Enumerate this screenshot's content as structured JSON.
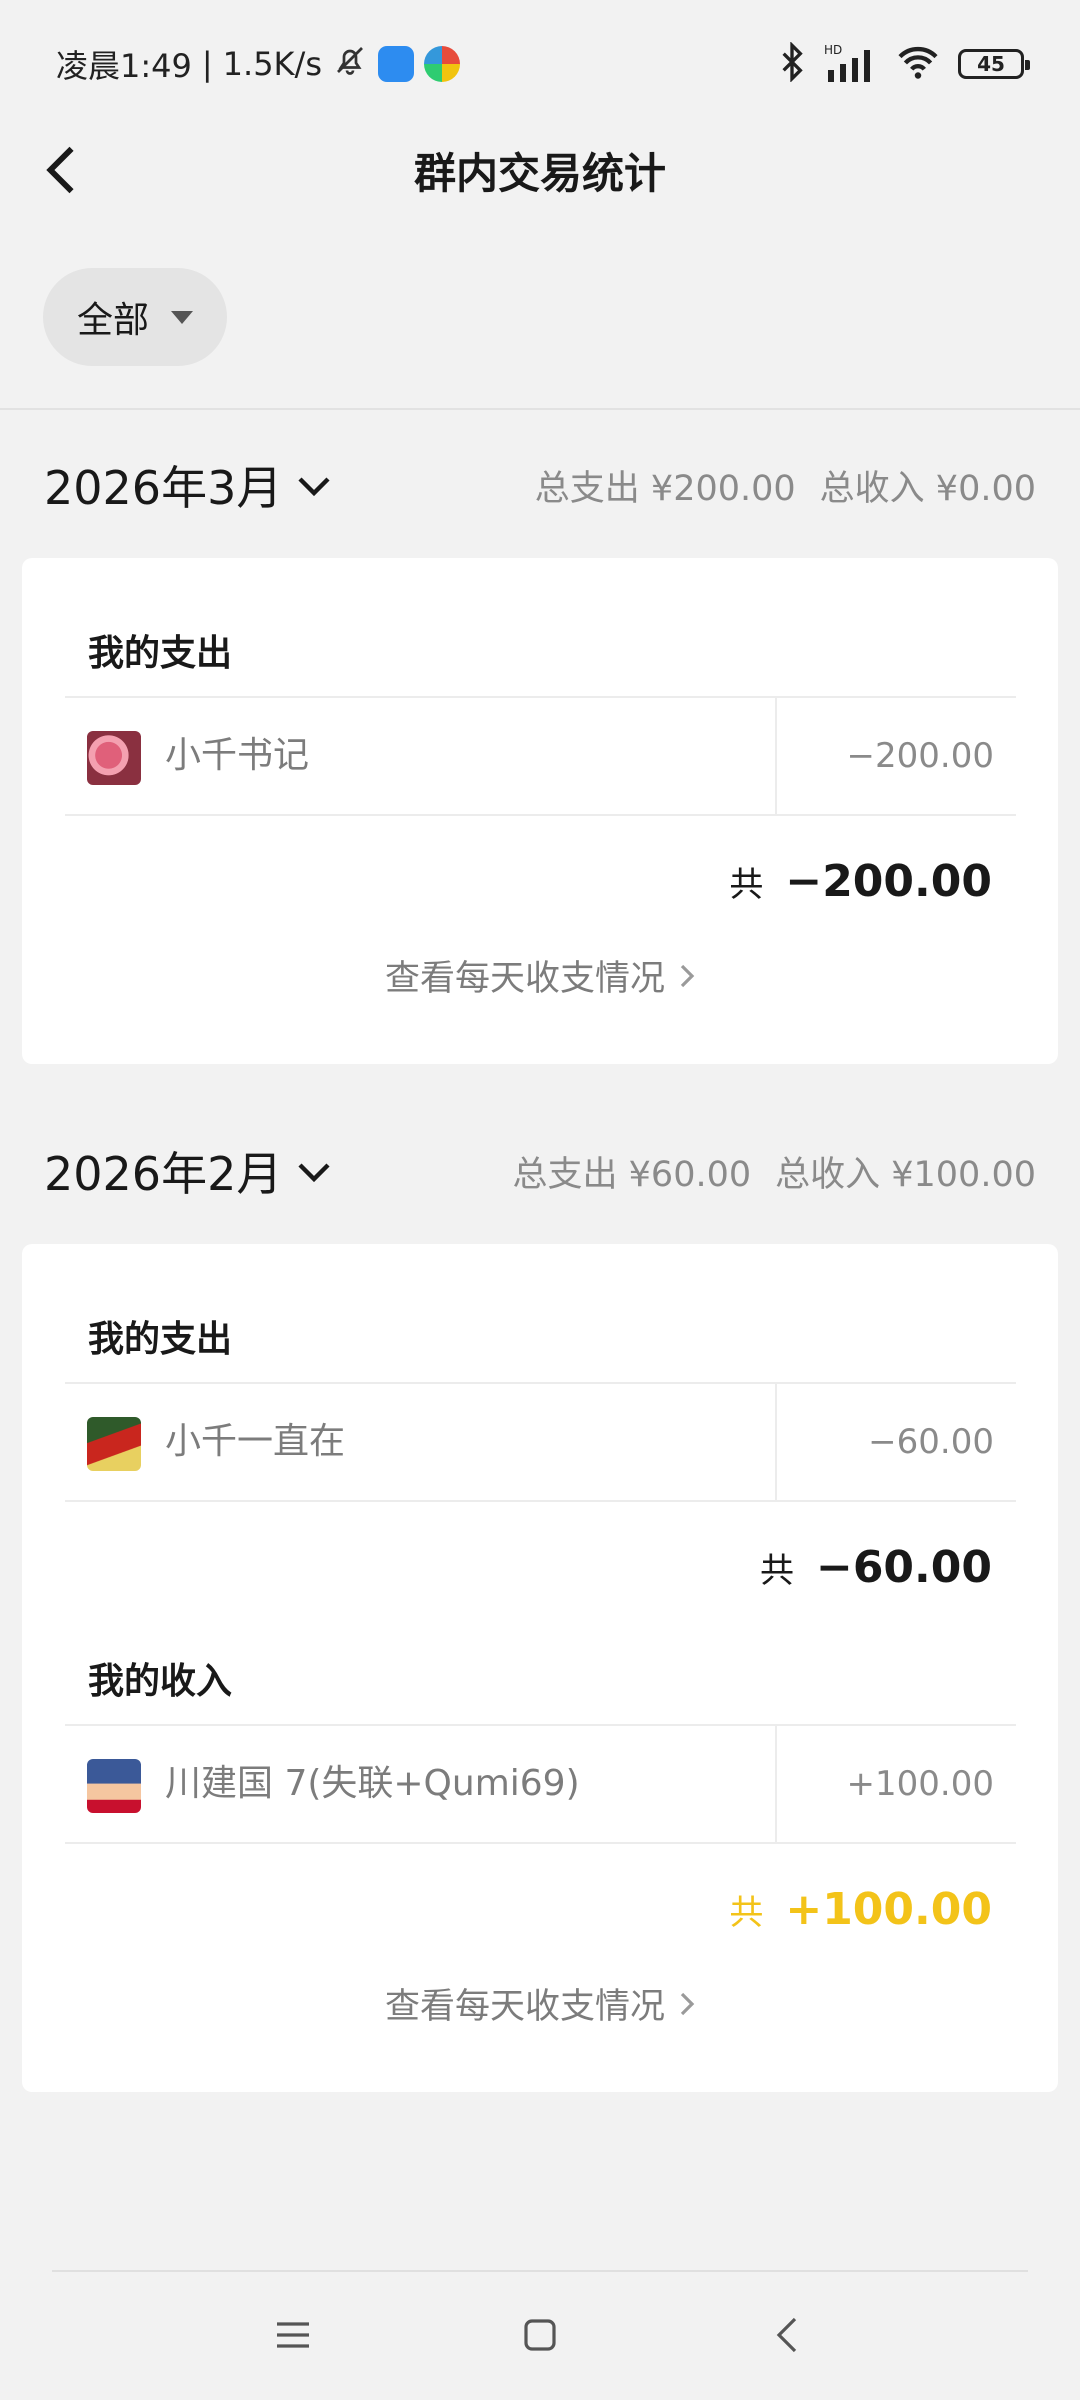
{
  "status_bar": {
    "time": "凌晨1:49",
    "speed": "1.5K/s",
    "separator": "|",
    "battery": "45",
    "network": "HD"
  },
  "header": {
    "title": "群内交易统计"
  },
  "filter": {
    "label": "全部"
  },
  "months": [
    {
      "label": "2026年3月",
      "summary_expense": "总支出 ¥200.00",
      "summary_income": "总收入 ¥0.00",
      "expense_section": {
        "title": "我的支出",
        "items": [
          {
            "name": "小千书记",
            "amount": "−200.00"
          }
        ],
        "total_prefix": "共",
        "total_value": "−200.00"
      },
      "daily_link": "查看每天收支情况"
    },
    {
      "label": "2026年2月",
      "summary_expense": "总支出 ¥60.00",
      "summary_income": "总收入 ¥100.00",
      "expense_section": {
        "title": "我的支出",
        "items": [
          {
            "name": "小千一直在",
            "amount": "−60.00"
          }
        ],
        "total_prefix": "共",
        "total_value": "−60.00"
      },
      "income_section": {
        "title": "我的收入",
        "items": [
          {
            "name": "川建国 7(失联+Qumi69)",
            "amount": "+100.00"
          }
        ],
        "total_prefix": "共",
        "total_value": "+100.00"
      },
      "daily_link": "查看每天收支情况"
    }
  ],
  "colors": {
    "background": "#f2f2f2",
    "card": "#ffffff",
    "income_accent": "#f3c319",
    "muted_text": "#8a8a8a"
  }
}
